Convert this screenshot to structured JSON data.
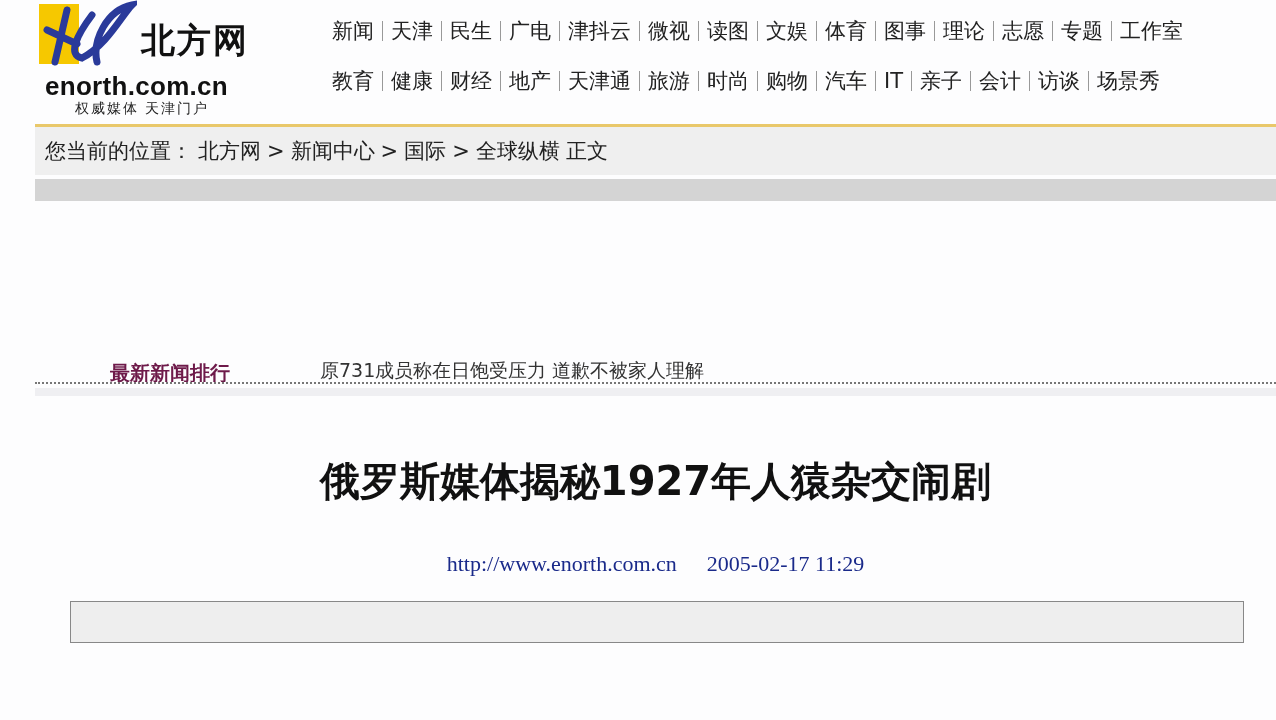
{
  "logo": {
    "name": "北方网",
    "domain": "enorth.com.cn",
    "slogan": "权威媒体 天津门户"
  },
  "nav": {
    "rows": [
      [
        "新闻",
        "天津",
        "民生",
        "广电",
        "津抖云",
        "微视",
        "读图",
        "文娱",
        "体育",
        "图事",
        "理论",
        "志愿",
        "专题",
        "工作室"
      ],
      [
        "教育",
        "健康",
        "财经",
        "地产",
        "天津通",
        "旅游",
        "时尚",
        "购物",
        "汽车",
        "IT",
        "亲子",
        "会计",
        "访谈",
        "场景秀"
      ]
    ]
  },
  "breadcrumb": {
    "label": "您当前的位置：",
    "items": [
      "北方网",
      "新闻中心",
      "国际",
      "全球纵横"
    ],
    "separator": ">",
    "page": "正文"
  },
  "ranking": {
    "title": "最新新闻排行",
    "items": [
      "原731成员称在日饱受压力 道歉不被家人理解"
    ]
  },
  "article": {
    "title": "俄罗斯媒体揭秘1927年人猿杂交闹剧",
    "source": "http://www.enorth.com.cn",
    "date": "2005-02-17 11:29"
  }
}
